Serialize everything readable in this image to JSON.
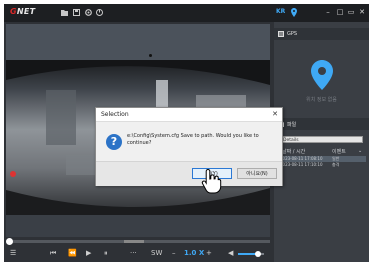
{
  "app": {
    "brand_prefix": "G",
    "brand_rest": "NET",
    "language_badge": "KR"
  },
  "colors": {
    "accent": "#3fa9f5",
    "brand_red": "#d62828",
    "dialog_icon_blue": "#2c73c7"
  },
  "titlebar": {
    "icons": [
      "folder-icon",
      "save-icon",
      "settings-icon",
      "config-icon"
    ],
    "window_controls": {
      "minimize": "–",
      "maximize": "□",
      "restore": "▭",
      "close": "✕"
    }
  },
  "player": {
    "speed": "1.0 X",
    "sw_label": "SW",
    "dots_label": "···",
    "volume_level": 0.75
  },
  "gps_panel": {
    "title": "GPS",
    "caption": "위치 정보 없음"
  },
  "file_panel": {
    "title": "파일",
    "search_value": "Details",
    "columns": {
      "date": "날짜 / 시간",
      "type": "이벤트"
    },
    "rows": [
      {
        "date": "2023-08-11 17:08:10",
        "type": "일반"
      },
      {
        "date": "2023-08-11 17:10:10",
        "type": "충격"
      }
    ]
  },
  "dialog": {
    "title": "Selection",
    "close": "✕",
    "message": "e:\\Config\\System.cfg Save to path. Would you like to continue?",
    "yes_label": "예(Y)",
    "no_label": "아니요(N)"
  }
}
